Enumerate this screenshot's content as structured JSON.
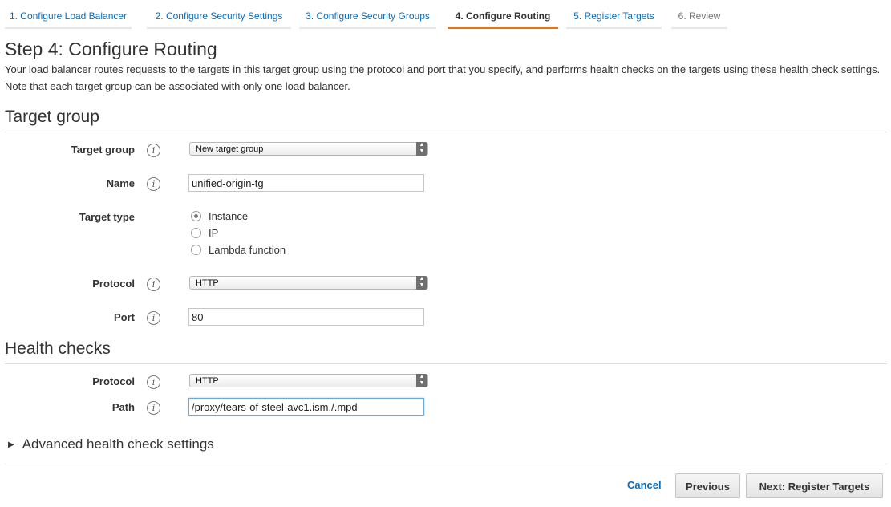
{
  "wizard": {
    "tabs": [
      {
        "label": "1. Configure Load Balancer"
      },
      {
        "label": "2. Configure Security Settings"
      },
      {
        "label": "3. Configure Security Groups"
      },
      {
        "label": "4. Configure Routing"
      },
      {
        "label": "5. Register Targets"
      },
      {
        "label": "6. Review"
      }
    ],
    "active_index": 3
  },
  "page": {
    "title": "Step 4: Configure Routing",
    "description": "Your load balancer routes requests to the targets in this target group using the protocol and port that you specify, and performs health checks on the targets using these health check settings. Note that each target group can be associated with only one load balancer."
  },
  "target_group": {
    "section_title": "Target group",
    "target_group_label": "Target group",
    "target_group_value": "New target group",
    "name_label": "Name",
    "name_value": "unified-origin-tg",
    "target_type_label": "Target type",
    "target_type_options": [
      {
        "label": "Instance",
        "selected": true
      },
      {
        "label": "IP",
        "selected": false
      },
      {
        "label": "Lambda function",
        "selected": false
      }
    ],
    "protocol_label": "Protocol",
    "protocol_value": "HTTP",
    "port_label": "Port",
    "port_value": "80"
  },
  "health_checks": {
    "section_title": "Health checks",
    "protocol_label": "Protocol",
    "protocol_value": "HTTP",
    "path_label": "Path",
    "path_value": "/proxy/tears-of-steel-avc1.ism./.mpd",
    "advanced_label": "Advanced health check settings"
  },
  "footer": {
    "cancel_label": "Cancel",
    "previous_label": "Previous",
    "next_label": "Next: Register Targets"
  },
  "icons": {
    "info": "i",
    "select_arrow_up": "▲",
    "select_arrow_down": "▼",
    "expand": "▶"
  },
  "colors": {
    "link": "#0a6ebd",
    "active_tab_underline": "#ec7211"
  }
}
